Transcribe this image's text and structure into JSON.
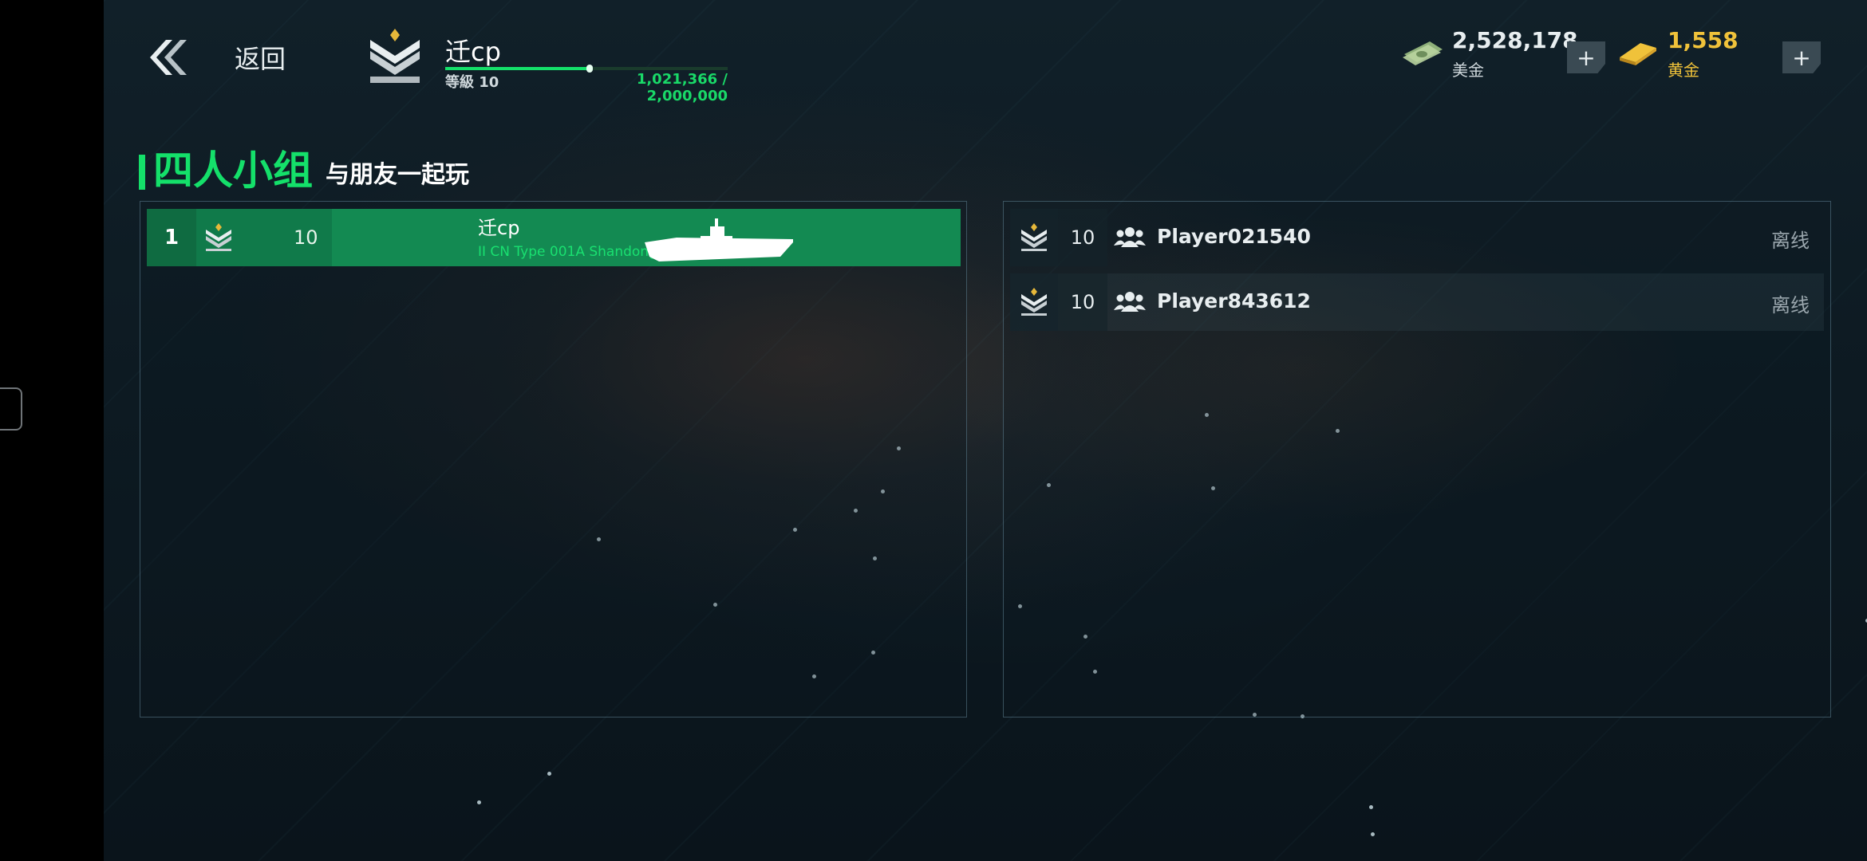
{
  "header": {
    "back_label": "返回",
    "player": {
      "name": "迁cp",
      "level_text": "等級 10",
      "xp_text": "1,021,366 / 2,000,000",
      "xp_fraction": 0.51
    },
    "currencies": [
      {
        "value": "2,528,178",
        "label": "美金",
        "color": "#e8eef0",
        "icon": "cash-icon"
      },
      {
        "value": "1,558",
        "label": "黄金",
        "color": "#f0c23a",
        "icon": "gold-bar-icon"
      }
    ],
    "plus_label": "+"
  },
  "section": {
    "title": "四人小组",
    "subtitle": "与朋友一起玩"
  },
  "team": {
    "members": [
      {
        "slot": "1",
        "level": "10",
        "name": "迁cp",
        "ship": "II CN Type 001A Shandong"
      }
    ]
  },
  "friends": [
    {
      "level": "10",
      "name": "Player021540",
      "status": "离线"
    },
    {
      "level": "10",
      "name": "Player843612",
      "status": "离线"
    }
  ],
  "colors": {
    "accent_green": "#14e06a",
    "gold": "#f0c23a",
    "row_green": "#138a52"
  }
}
